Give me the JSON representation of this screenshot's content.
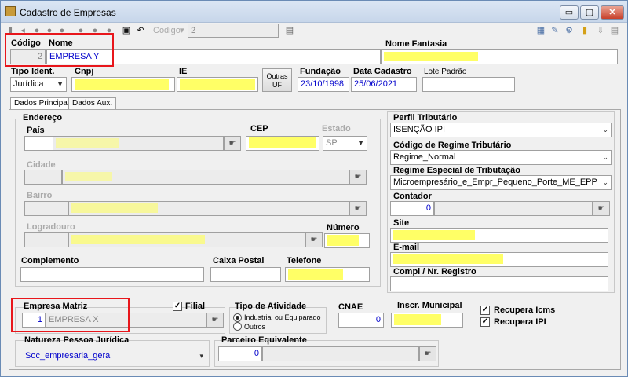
{
  "window": {
    "title": "Cadastro de Empresas",
    "min": "▭",
    "max": "▢",
    "close": "✕"
  },
  "toolbar": {
    "codigo_label": "Codigo",
    "codigo_value": "2"
  },
  "header": {
    "codigo_label": "Código",
    "codigo_value": "2",
    "nome_label": "Nome",
    "nome_value": "EMPRESA Y",
    "nome_fantasia_label": "Nome Fantasia",
    "tipo_ident_label": "Tipo Ident.",
    "tipo_ident_value": "Jurídica",
    "cnpj_label": "Cnpj",
    "ie_label": "IE",
    "outras_uf_label": "Outras\nUF",
    "fundacao_label": "Fundação",
    "fundacao_value": "23/10/1998",
    "data_cadastro_label": "Data Cadastro",
    "data_cadastro_value": "25/06/2021",
    "lote_padrao_label": "Lote Padrão"
  },
  "tabs": [
    {
      "label": "Dados Principais"
    },
    {
      "label": "Dados Aux."
    }
  ],
  "endereco": {
    "title": "Endereço",
    "pais_label": "País",
    "cep_label": "CEP",
    "estado_label": "Estado",
    "estado_value": "SP",
    "cidade_label": "Cidade",
    "bairro_label": "Bairro",
    "logradouro_label": "Logradouro",
    "numero_label": "Número",
    "complemento_label": "Complemento",
    "caixa_postal_label": "Caixa Postal",
    "telefone_label": "Telefone"
  },
  "tributario": {
    "perfil_label": "Perfil Tributário",
    "perfil_value": "ISENÇÃO IPI",
    "regime_label": "Código de Regime Tributário",
    "regime_value": "Regime_Normal",
    "regime_especial_label": "Regime Especial de Tributação",
    "regime_especial_value": "Microempresário_e_Empr_Pequeno_Porte_ME_EPP",
    "contador_label": "Contador",
    "contador_value": "0",
    "site_label": "Site",
    "email_label": "E-mail",
    "compl_registro_label": "Compl / Nr. Registro"
  },
  "bottom": {
    "empresa_matriz_label": "Empresa Matriz",
    "matriz_code": "1",
    "matriz_name": "EMPRESA X",
    "filial_label": "Filial",
    "tipo_atividade_label": "Tipo de Atividade",
    "atividade_opt1": "Industrial ou Equiparado",
    "atividade_opt2": "Outros",
    "cnae_label": "CNAE",
    "cnae_value": "0",
    "inscr_municipal_label": "Inscr. Municipal",
    "recupera_icms_label": "Recupera Icms",
    "recupera_ipi_label": "Recupera IPI",
    "natureza_label": "Natureza Pessoa Jurídica",
    "natureza_value": "Soc_empresaria_geral",
    "parceiro_label": "Parceiro Equivalente",
    "parceiro_value": "0"
  }
}
